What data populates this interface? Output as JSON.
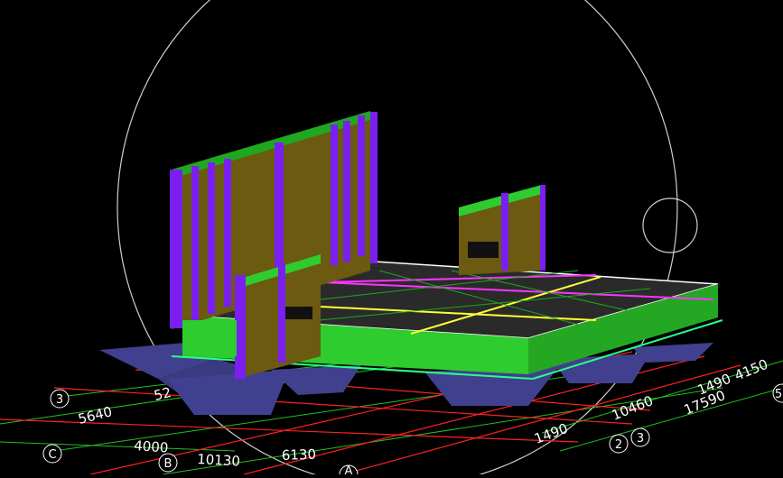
{
  "viewport": {
    "background": "#000000",
    "grid_colors": {
      "major": "#ff2020",
      "minor": "#22c022",
      "marker": "#ffffff"
    },
    "model_colors": {
      "footing": "#40408f",
      "slab_side": "#2ecc2e",
      "slab_top": "#2a2a2a",
      "wall_panel": "#6b5a10",
      "column": "#7a1ff0",
      "beam_top": "#1fa81f",
      "highlight_yellow": "#ffff33",
      "highlight_magenta": "#ff33ff"
    },
    "axis_bubbles": {
      "left_3": "3",
      "left_c": "C",
      "left_b": "B",
      "bottom_a": "A",
      "right_2": "2",
      "right_3": "3",
      "right_edge_5": "5"
    },
    "dimensions": {
      "d5640": "5640",
      "d4000": "4000",
      "d10130": "10130",
      "d6130": "6130",
      "d52": "52",
      "d1490_lower": "1490",
      "d10460": "10460",
      "d1490_upper": "1490",
      "d4150": "4150",
      "d17590": "17590"
    },
    "navigator_icon": "orbit-circle-icon"
  }
}
